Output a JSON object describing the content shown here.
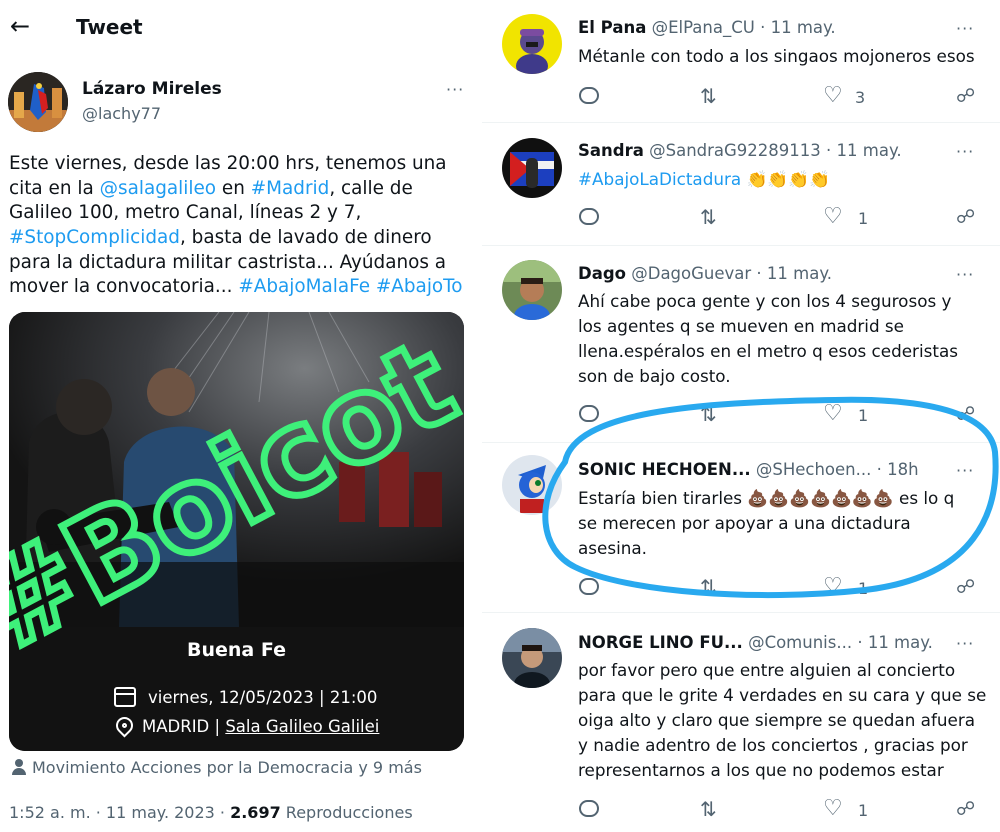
{
  "header": {
    "title": "Tweet",
    "back_icon": "arrow-left-icon"
  },
  "tweet": {
    "author_name": "Lázaro Mireles",
    "author_handle": "@lachy77",
    "more": "···",
    "text_lines": [
      [
        {
          "t": "Este viernes, desde las 20:00 hrs, tenemos una",
          "link": false
        }
      ],
      [
        {
          "t": "cita en la ",
          "link": false
        },
        {
          "t": "@salagalileo",
          "link": true
        },
        {
          "t": "  en ",
          "link": false
        },
        {
          "t": "#Madrid",
          "link": true
        },
        {
          "t": ", calle de",
          "link": false
        }
      ],
      [
        {
          "t": "Galileo 100, metro Canal, líneas 2 y 7,",
          "link": false
        }
      ],
      [
        {
          "t": "#StopComplicidad",
          "link": true
        },
        {
          "t": ", basta de lavado de dinero",
          "link": false
        }
      ],
      [
        {
          "t": "para la dictadura militar castrista... Ayúdanos a",
          "link": false
        }
      ],
      [
        {
          "t": "mover la convocatoria... ",
          "link": false
        },
        {
          "t": "#AbajoMalaFe",
          "link": true
        },
        {
          "t": " ",
          "link": false
        },
        {
          "t": "#AbajoTo",
          "link": true
        }
      ]
    ],
    "card": {
      "overlay_text": "#Boicot",
      "event_title": "Buena Fe",
      "event_date": "viernes, 12/05/2023 | 21:00",
      "event_city": "MADRID",
      "event_sep": " | ",
      "event_venue": "Sala Galileo Galilei"
    },
    "tagged": "Movimiento Acciones por la Democracia y 9 más",
    "time": "1:52 a. m. · 11 may. 2023 · ",
    "views_count": "2.697",
    "views_label": " Reproducciones"
  },
  "replies": [
    {
      "name": "El Pana",
      "handle": "@ElPana_CU · 11 may.",
      "lines": [
        [
          {
            "t": "Métanle con todo a los singaos mojoneros esos",
            "link": false
          }
        ]
      ],
      "likes": "3",
      "retweets": "",
      "replies": ""
    },
    {
      "name": "Sandra",
      "handle": "@SandraG92289113 · 11 may.",
      "lines": [
        [
          {
            "t": "#AbajoLaDictadura",
            "link": true
          },
          {
            "t": " 👏👏👏👏",
            "link": false
          }
        ]
      ],
      "likes": "1",
      "retweets": "",
      "replies": ""
    },
    {
      "name": "Dago",
      "handle": "@DagoGuevar · 11 may.",
      "lines": [
        [
          {
            "t": "Ahí  cabe poca gente y con los 4 segurosos y",
            "link": false
          }
        ],
        [
          {
            "t": "los agentes q se mueven en madrid se",
            "link": false
          }
        ],
        [
          {
            "t": "llena.espéralos en el metro q esos cederistas",
            "link": false
          }
        ],
        [
          {
            "t": "son de bajo costo.",
            "link": false
          }
        ]
      ],
      "likes": "1",
      "retweets": "",
      "replies": ""
    },
    {
      "name": "SONIC HECHOEN...",
      "handle": "  @SHechoen... · 18h",
      "lines": [
        [
          {
            "t": "Estaría bien tirarles ",
            "link": false
          },
          {
            "t": "💩💩💩💩💩💩💩",
            "link": false
          },
          {
            "t": " es lo q",
            "link": false
          }
        ],
        [
          {
            "t": "se merecen por apoyar a una dictadura",
            "link": false
          }
        ],
        [
          {
            "t": "asesina.",
            "link": false
          }
        ]
      ],
      "likes": "1",
      "retweets": "",
      "replies": ""
    },
    {
      "name": "NORGE LINO FU...",
      "handle": " @Comunis... · 11 may.",
      "lines": [
        [
          {
            "t": "por favor pero que entre alguien al concierto",
            "link": false
          }
        ],
        [
          {
            "t": "para que le grite 4 verdades en su cara y que se",
            "link": false
          }
        ],
        [
          {
            "t": "oiga alto y claro que siempre se quedan afuera",
            "link": false
          }
        ],
        [
          {
            "t": "y nadie adentro de los conciertos , gracias por",
            "link": false
          }
        ],
        [
          {
            "t": "representarnos a los que no podemos estar",
            "link": false
          }
        ]
      ],
      "likes": "1",
      "retweets": "",
      "replies": ""
    }
  ],
  "icons": {
    "reply": "reply-icon",
    "retweet": "retweet-icon",
    "like": "heart-icon",
    "share": "share-icon",
    "more": "more-icon"
  },
  "colors": {
    "link": "#1d9bf0",
    "secondary": "#536471",
    "highlight": "#29a9ef",
    "overlay": "#3ef07a"
  }
}
